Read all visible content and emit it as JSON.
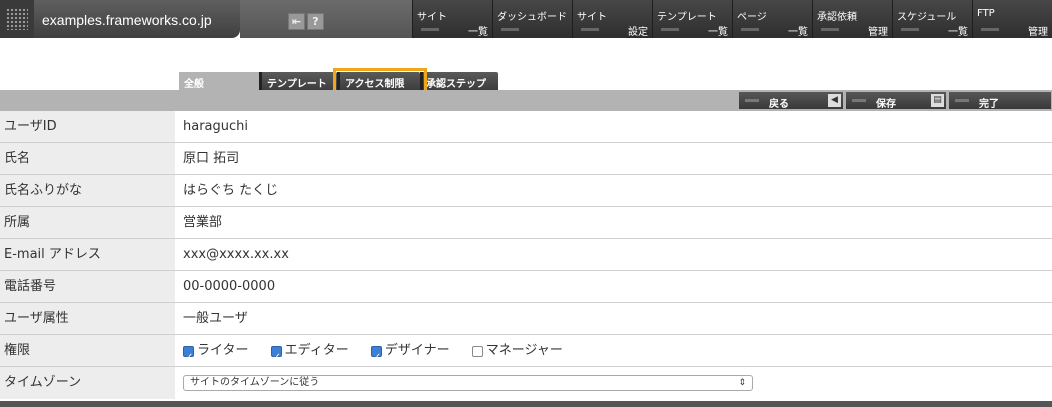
{
  "header": {
    "site_name": "examples.frameworks.co.jp",
    "icons": [
      "back-icon",
      "help-icon"
    ],
    "help_glyph": "?",
    "nav": [
      {
        "line1": "サイト",
        "line2": "一覧"
      },
      {
        "line1": "ダッシュボード",
        "line2": ""
      },
      {
        "line1": "サイト",
        "line2": "設定"
      },
      {
        "line1": "テンプレート",
        "line2": "一覧"
      },
      {
        "line1": "ページ",
        "line2": "一覧"
      },
      {
        "line1": "承認依頼",
        "line2": "管理"
      },
      {
        "line1": "スケジュール",
        "line2": "一覧"
      },
      {
        "line1": "FTP",
        "line2": "管理"
      }
    ]
  },
  "tabs": [
    {
      "label": "全般",
      "active": true
    },
    {
      "label": "テンプレート",
      "active": false
    },
    {
      "label": "アクセス制限",
      "active": false
    },
    {
      "label": "承認ステップ",
      "active": false
    }
  ],
  "toolbar": {
    "back_label": "戻る",
    "save_label": "保存",
    "done_label": "完了"
  },
  "form": {
    "rows": [
      {
        "label": "ユーザID",
        "value": "haraguchi"
      },
      {
        "label": "氏名",
        "value": "原口 拓司"
      },
      {
        "label": "氏名ふりがな",
        "value": "はらぐち たくじ"
      },
      {
        "label": "所属",
        "value": "営業部"
      },
      {
        "label": "E-mail アドレス",
        "value": "xxx@xxxx.xx.xx"
      },
      {
        "label": "電話番号",
        "value": "00-0000-0000"
      },
      {
        "label": "ユーザ属性",
        "value": "一般ユーザ"
      }
    ],
    "permissions_label": "権限",
    "permissions": [
      {
        "label": "ライター",
        "checked": true
      },
      {
        "label": "エディター",
        "checked": true
      },
      {
        "label": "デザイナー",
        "checked": true
      },
      {
        "label": "マネージャー",
        "checked": false
      }
    ],
    "timezone_label": "タイムゾーン",
    "timezone_value": "サイトのタイムゾーンに従う"
  },
  "colors": {
    "highlight": "#f0a51a",
    "checkbox": "#3b7fd6"
  }
}
